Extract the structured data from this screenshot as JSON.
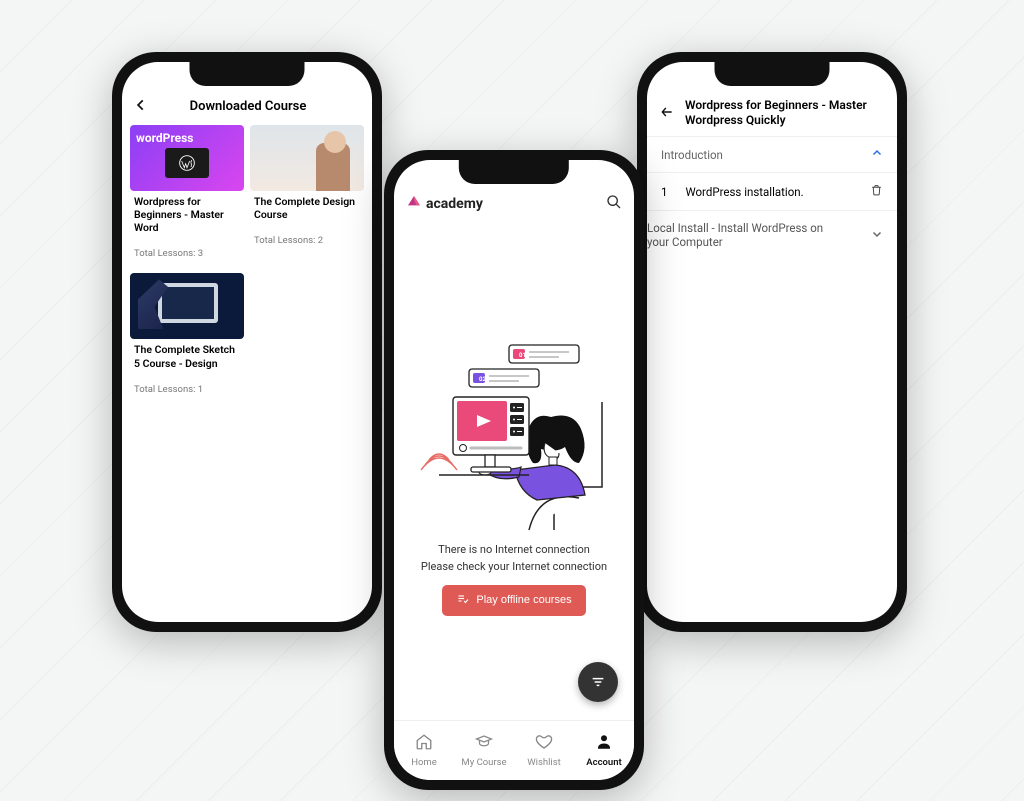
{
  "phone1": {
    "header_title": "Downloaded Course",
    "wp_label": "wordPress",
    "cards": [
      {
        "title": "Wordpress for Beginners - Master Word",
        "lessons": "Total Lessons: 3"
      },
      {
        "title": "The Complete Design Course",
        "lessons": "Total Lessons: 2"
      },
      {
        "title": "The Complete Sketch 5 Course - Design",
        "lessons": "Total Lessons: 1"
      }
    ]
  },
  "phone2": {
    "brand_name": "academy",
    "msg_line1": "There is no Internet connection",
    "msg_line2": "Please check your Internet connection",
    "offline_btn": "Play offline courses",
    "tabs": [
      {
        "label": "Home"
      },
      {
        "label": "My Course"
      },
      {
        "label": "Wishlist"
      },
      {
        "label": "Account"
      }
    ]
  },
  "phone3": {
    "title": "Wordpress for Beginners - Master Wordpress Quickly",
    "section1": "Introduction",
    "lesson_num": "1",
    "lesson_title": "WordPress installation.",
    "section2": "Local Install - Install WordPress on your Computer"
  }
}
